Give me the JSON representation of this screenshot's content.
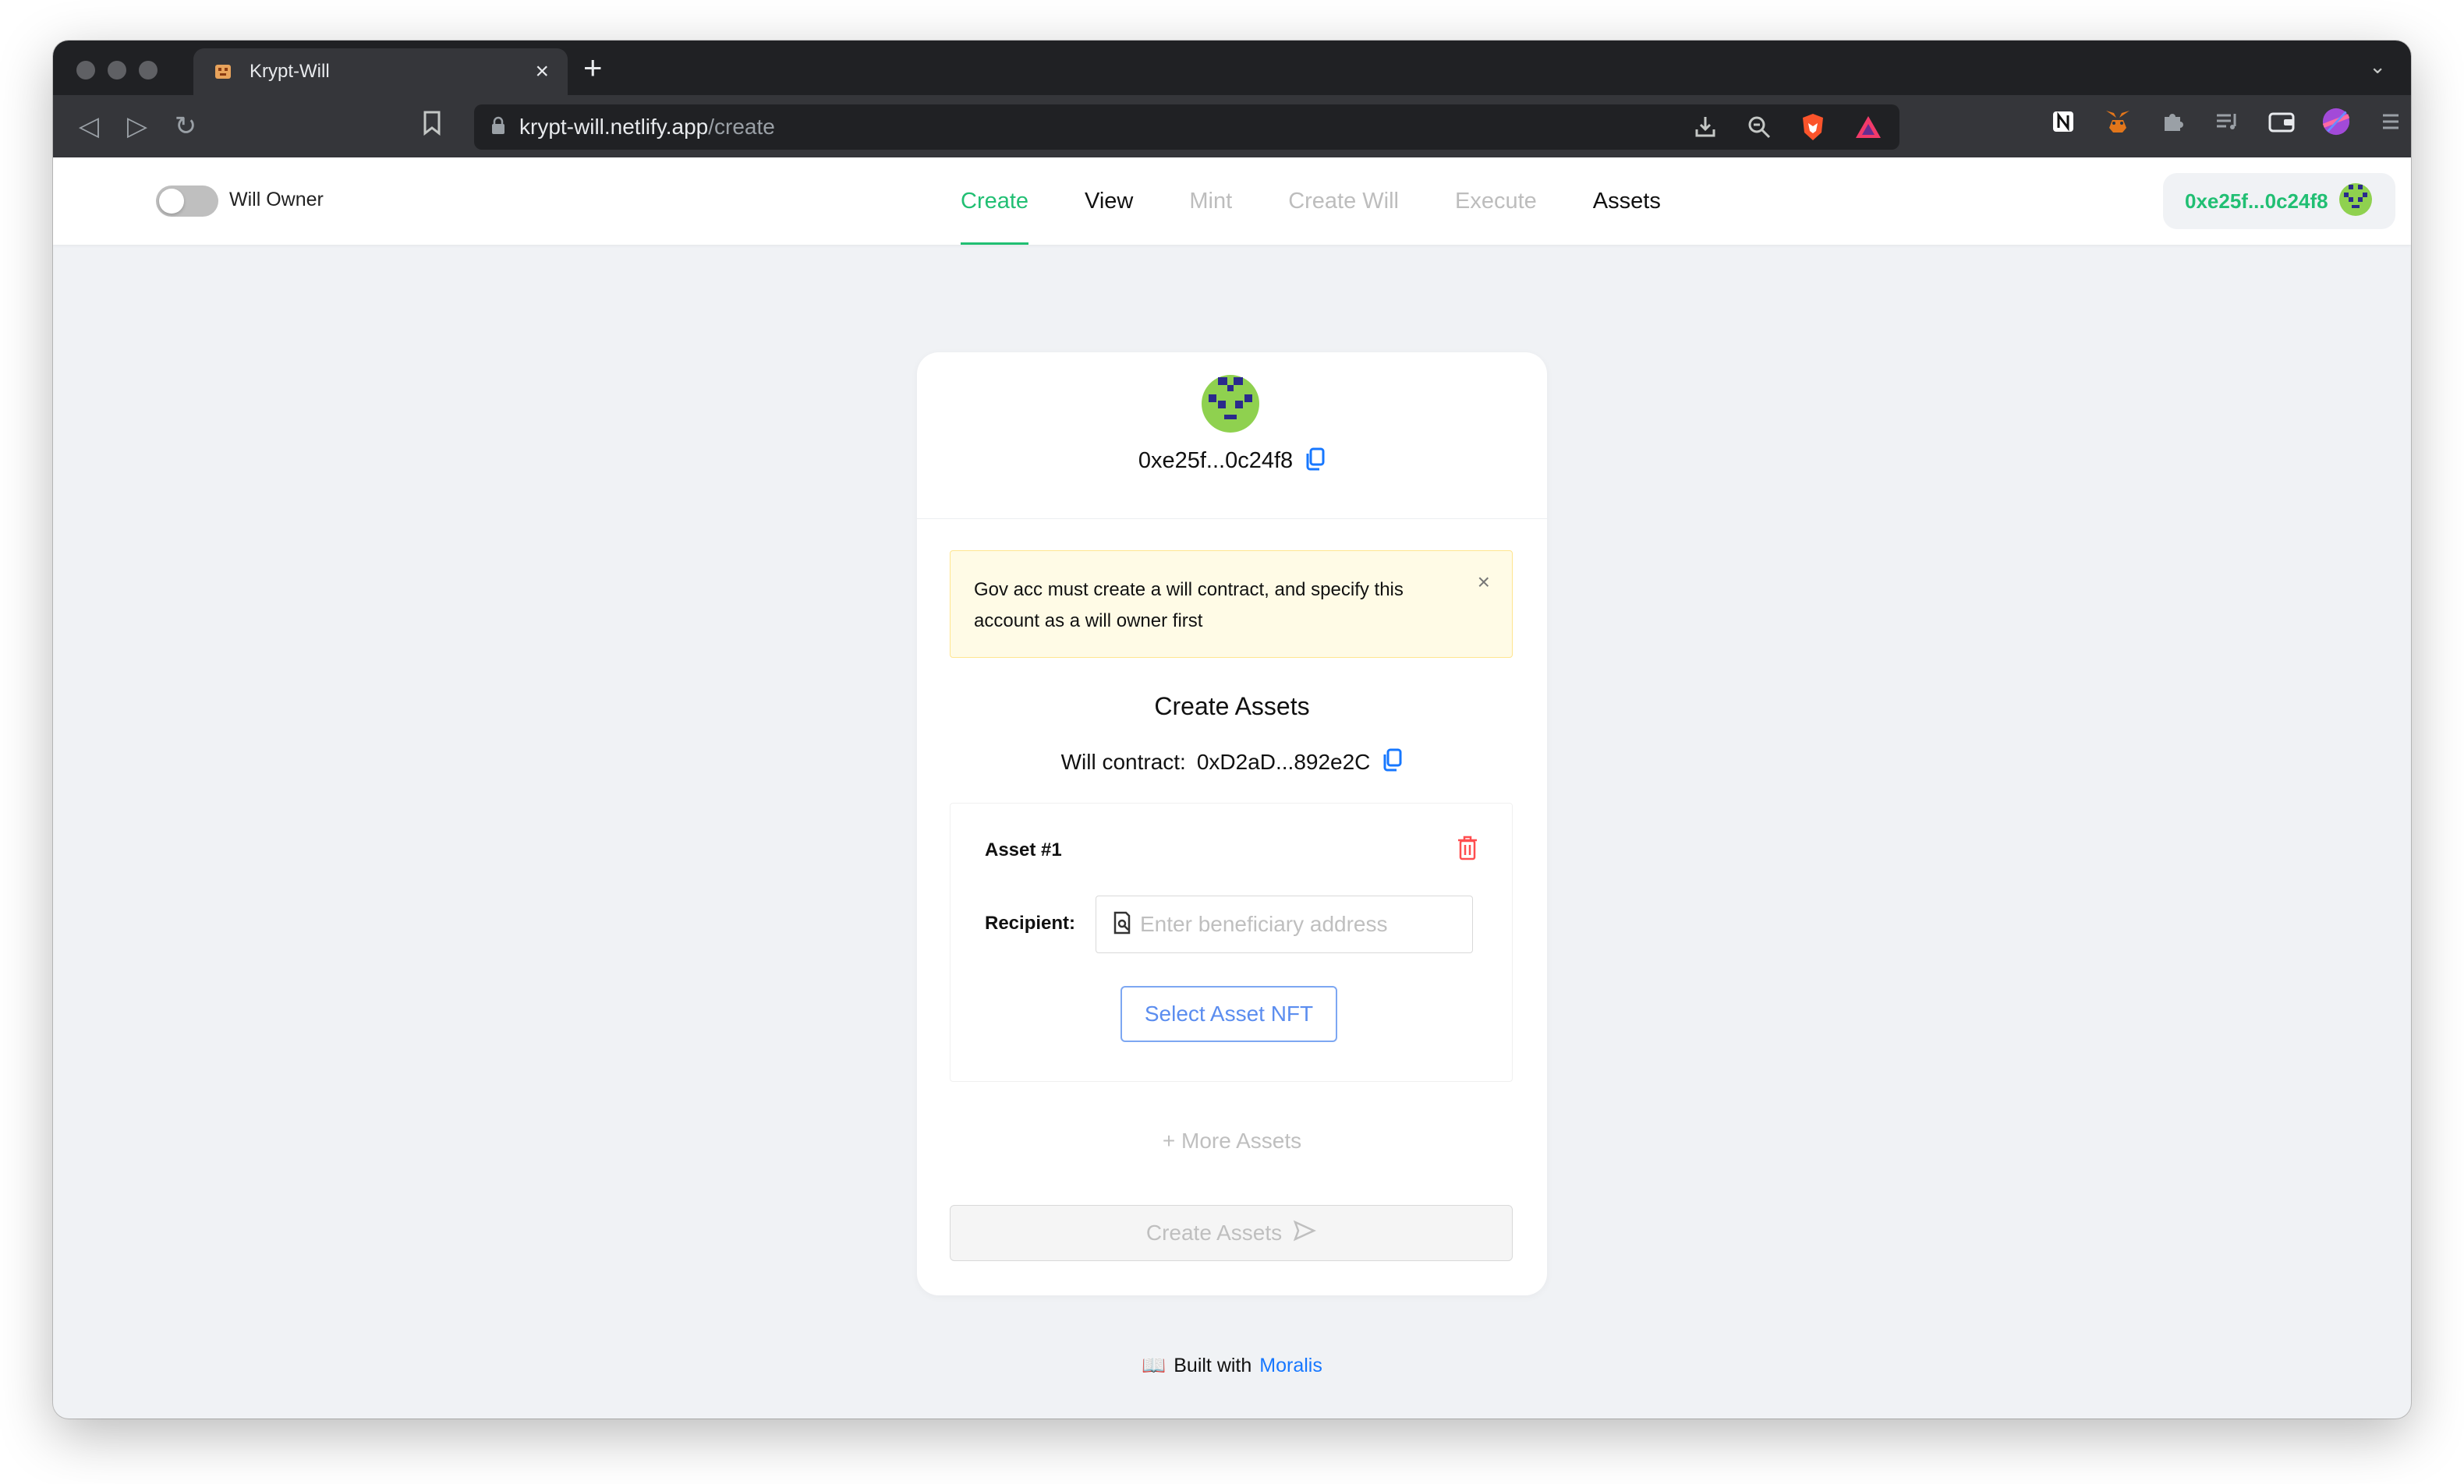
{
  "browser": {
    "tab_title": "Krypt-Will",
    "url_host": "krypt-will.netlify.app",
    "url_path": "/create"
  },
  "header": {
    "toggle_label": "Will Owner",
    "toggle_on": false,
    "menu": [
      "Create",
      "View",
      "Mint",
      "Create Will",
      "Execute",
      "Assets"
    ],
    "active_menu": "Create",
    "account_short": "0xe25f...0c24f8"
  },
  "card": {
    "address_short": "0xe25f...0c24f8",
    "alert_text": "Gov acc must create a will contract, and specify this account as a will owner first",
    "title": "Create Assets",
    "contract_label": "Will contract:",
    "contract_address": "0xD2aD...892e2C",
    "asset": {
      "title": "Asset #1",
      "recipient_label": "Recipient:",
      "recipient_placeholder": "Enter beneficiary address",
      "select_button": "Select Asset NFT"
    },
    "more_assets": "+ More Assets",
    "create_button": "Create Assets"
  },
  "footer": {
    "icon": "📖",
    "prefix": "Built with",
    "link": "Moralis"
  },
  "colors": {
    "accent_green": "#21bf73",
    "link_blue": "#1677ff",
    "page_bg": "#f0f2f5"
  }
}
